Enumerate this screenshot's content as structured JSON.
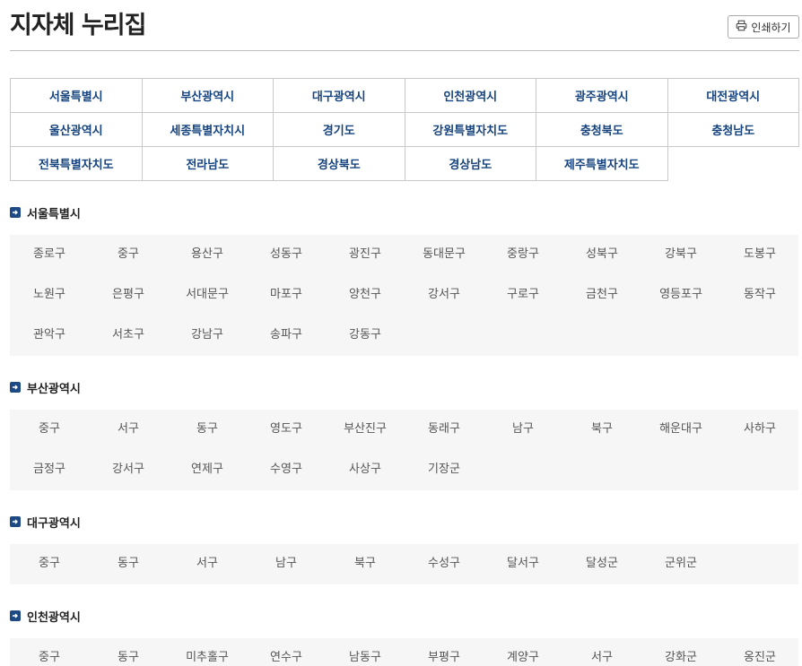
{
  "header": {
    "title": "지자체 누리집",
    "print_label": "인쇄하기"
  },
  "regions": [
    "서울특별시",
    "부산광역시",
    "대구광역시",
    "인천광역시",
    "광주광역시",
    "대전광역시",
    "울산광역시",
    "세종특별자치시",
    "경기도",
    "강원특별자치도",
    "충청북도",
    "충청남도",
    "전북특별자치도",
    "전라남도",
    "경상북도",
    "경상남도",
    "제주특별자치도"
  ],
  "sections": [
    {
      "title": "서울특별시",
      "districts": [
        "종로구",
        "중구",
        "용산구",
        "성동구",
        "광진구",
        "동대문구",
        "중랑구",
        "성북구",
        "강북구",
        "도봉구",
        "노원구",
        "은평구",
        "서대문구",
        "마포구",
        "양천구",
        "강서구",
        "구로구",
        "금천구",
        "영등포구",
        "동작구",
        "관악구",
        "서초구",
        "강남구",
        "송파구",
        "강동구"
      ]
    },
    {
      "title": "부산광역시",
      "districts": [
        "중구",
        "서구",
        "동구",
        "영도구",
        "부산진구",
        "동래구",
        "남구",
        "북구",
        "해운대구",
        "사하구",
        "금정구",
        "강서구",
        "연제구",
        "수영구",
        "사상구",
        "기장군"
      ]
    },
    {
      "title": "대구광역시",
      "districts": [
        "중구",
        "동구",
        "서구",
        "남구",
        "북구",
        "수성구",
        "달서구",
        "달성군",
        "군위군"
      ]
    },
    {
      "title": "인천광역시",
      "districts": [
        "중구",
        "동구",
        "미추홀구",
        "연수구",
        "남동구",
        "부평구",
        "계양구",
        "서구",
        "강화군",
        "옹진군"
      ]
    }
  ]
}
